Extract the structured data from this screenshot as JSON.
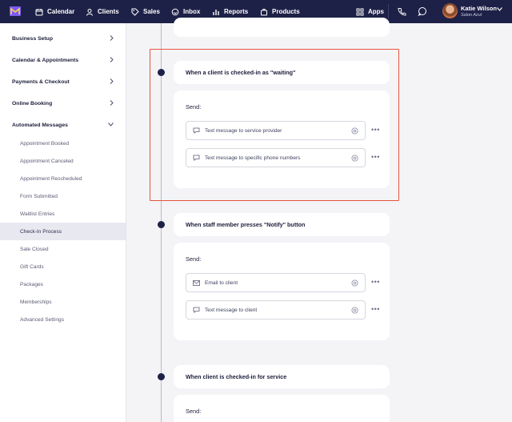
{
  "nav": {
    "items": [
      {
        "label": "Calendar"
      },
      {
        "label": "Clients"
      },
      {
        "label": "Sales"
      },
      {
        "label": "Inbox"
      },
      {
        "label": "Reports"
      },
      {
        "label": "Products"
      },
      {
        "label": "Apps"
      }
    ],
    "user": {
      "name": "Katie Wilson",
      "business": "Salon Azul"
    }
  },
  "sidebar": {
    "sections": [
      {
        "label": "Business Setup"
      },
      {
        "label": "Calendar & Appointments"
      },
      {
        "label": "Payments & Checkout"
      },
      {
        "label": "Online Booking"
      },
      {
        "label": "Automated Messages"
      }
    ],
    "sub_items": [
      {
        "label": "Appointment Booked"
      },
      {
        "label": "Appointment Canceled"
      },
      {
        "label": "Appointment Rescheduled"
      },
      {
        "label": "Form Submitted"
      },
      {
        "label": "Waitlist Entries"
      },
      {
        "label": "Check-In Process",
        "active": true
      },
      {
        "label": "Sale Closed"
      },
      {
        "label": "Gift Cards"
      },
      {
        "label": "Packages"
      },
      {
        "label": "Memberships"
      },
      {
        "label": "Advanced Settings"
      }
    ]
  },
  "triggers": [
    {
      "title": "When a client is checked-in as \"waiting\"",
      "send_label": "Send:",
      "actions": [
        {
          "label": "Text message to service provider",
          "icon": "chat-bubble-icon"
        },
        {
          "label": "Text message to specific phone numbers",
          "icon": "chat-bubble-icon"
        }
      ]
    },
    {
      "title": "When staff member presses \"Notify\" button",
      "send_label": "Send:",
      "actions": [
        {
          "label": "Email to client",
          "icon": "envelope-icon"
        },
        {
          "label": "Text message to client",
          "icon": "chat-bubble-icon"
        }
      ]
    },
    {
      "title": "When client is checked-in for service",
      "send_label": "Send:",
      "actions": []
    }
  ],
  "more_label": "•••",
  "colors": {
    "nav_bg": "#1e2147",
    "highlight": "#e5553e",
    "sidebar_active": "#e8e9f0"
  }
}
